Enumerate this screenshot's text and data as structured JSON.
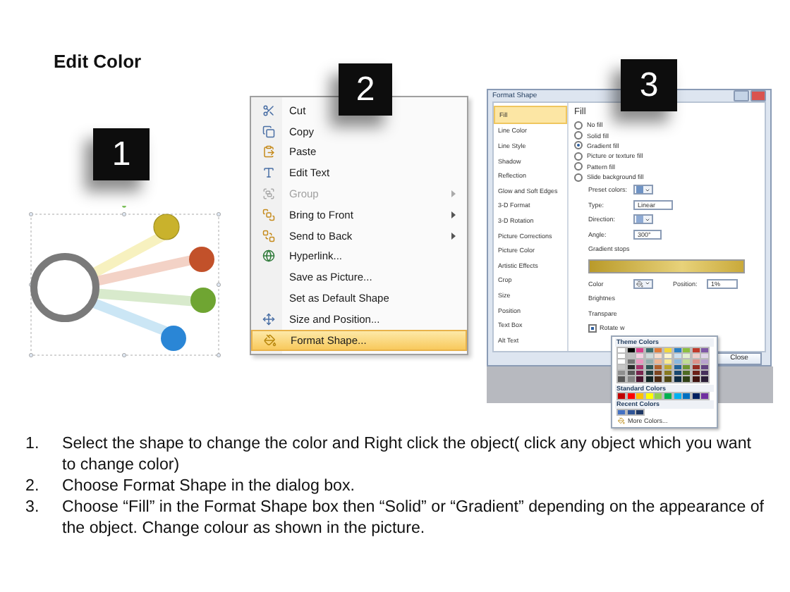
{
  "title": "Edit Color",
  "steps": [
    "1",
    "2",
    "3"
  ],
  "context_menu": {
    "items": [
      {
        "label": "Cut",
        "disabled": false,
        "submenu": false,
        "selected": false
      },
      {
        "label": "Copy",
        "disabled": false,
        "submenu": false,
        "selected": false
      },
      {
        "label": "Paste",
        "disabled": false,
        "submenu": false,
        "selected": false
      },
      {
        "label": "Edit Text",
        "disabled": false,
        "submenu": false,
        "selected": false
      },
      {
        "label": "Group",
        "disabled": true,
        "submenu": true,
        "selected": false
      },
      {
        "label": "Bring to Front",
        "disabled": false,
        "submenu": true,
        "selected": false
      },
      {
        "label": "Send to Back",
        "disabled": false,
        "submenu": true,
        "selected": false
      },
      {
        "label": "Hyperlink...",
        "disabled": false,
        "submenu": false,
        "selected": false
      },
      {
        "label": "Save as Picture...",
        "disabled": false,
        "submenu": false,
        "selected": false
      },
      {
        "label": "Set as Default Shape",
        "disabled": false,
        "submenu": false,
        "selected": false
      },
      {
        "label": "Size and Position...",
        "disabled": false,
        "submenu": false,
        "selected": false
      },
      {
        "label": "Format Shape...",
        "disabled": false,
        "submenu": false,
        "selected": true
      }
    ]
  },
  "dialog": {
    "title": "Format Shape",
    "categories": [
      {
        "label": "Fill",
        "selected": true
      },
      {
        "label": "Line Color",
        "selected": false
      },
      {
        "label": "Line Style",
        "selected": false
      },
      {
        "label": "Shadow",
        "selected": false
      },
      {
        "label": "Reflection",
        "selected": false
      },
      {
        "label": "Glow and Soft Edges",
        "selected": false
      },
      {
        "label": "3-D Format",
        "selected": false
      },
      {
        "label": "3-D Rotation",
        "selected": false
      },
      {
        "label": "Picture Corrections",
        "selected": false
      },
      {
        "label": "Picture Color",
        "selected": false
      },
      {
        "label": "Artistic Effects",
        "selected": false
      },
      {
        "label": "Crop",
        "selected": false
      },
      {
        "label": "Size",
        "selected": false
      },
      {
        "label": "Position",
        "selected": false
      },
      {
        "label": "Text Box",
        "selected": false
      },
      {
        "label": "Alt Text",
        "selected": false
      }
    ],
    "heading": "Fill",
    "fill_options": [
      {
        "label": "No fill",
        "selected": false
      },
      {
        "label": "Solid fill",
        "selected": false
      },
      {
        "label": "Gradient fill",
        "selected": true
      },
      {
        "label": "Picture or texture fill",
        "selected": false
      },
      {
        "label": "Pattern fill",
        "selected": false
      },
      {
        "label": "Slide background fill",
        "selected": false
      }
    ],
    "preset_label": "Preset colors:",
    "type_label": "Type:",
    "type_value": "Linear",
    "direction_label": "Direction:",
    "angle_label": "Angle:",
    "angle_value": "300°",
    "stops_label": "Gradient stops",
    "color_label": "Color",
    "position_label": "Position:",
    "position_value": "1%",
    "brightness_label": "Brightnes",
    "transparency_label": "Transpare",
    "rotate_label": "Rotate w",
    "rotate_checked": true,
    "close_button": "Close",
    "color_picker": {
      "theme_title": "Theme Colors",
      "theme_colors": [
        {
          "color": "#ffffff"
        },
        {
          "color": "#000000"
        },
        {
          "color": "#d8418c"
        },
        {
          "color": "#3c6e6e"
        },
        {
          "color": "#e07b39"
        },
        {
          "color": "#f2d83b"
        },
        {
          "color": "#2a7fc4"
        },
        {
          "color": "#8cbf3f"
        },
        {
          "color": "#c0392b"
        },
        {
          "color": "#7e57a6"
        }
      ],
      "standard_title": "Standard Colors",
      "standard_colors": [
        {
          "color": "#c00000"
        },
        {
          "color": "#ff0000"
        },
        {
          "color": "#ffc000"
        },
        {
          "color": "#ffff00"
        },
        {
          "color": "#92d050"
        },
        {
          "color": "#00b050"
        },
        {
          "color": "#00b0f0"
        },
        {
          "color": "#0070c0"
        },
        {
          "color": "#002060"
        },
        {
          "color": "#7030a0"
        }
      ],
      "recent_title": "Recent Colors",
      "recent_colors": [
        {
          "color": "#4472c4"
        },
        {
          "color": "#2f5597"
        },
        {
          "color": "#1f3864"
        }
      ],
      "more_label": "More Colors..."
    }
  },
  "instructions": [
    {
      "number": "1.",
      "text": "Select the shape to change the color and Right click the object( click any object which you want to change color)"
    },
    {
      "number": "2.",
      "text": "Choose Format Shape in the dialog box."
    },
    {
      "number": "3.",
      "text": "Choose “Fill” in the Format Shape box then “Solid” or “Gradient” depending on the appearance of the object. Change colour as shown in the picture."
    }
  ]
}
